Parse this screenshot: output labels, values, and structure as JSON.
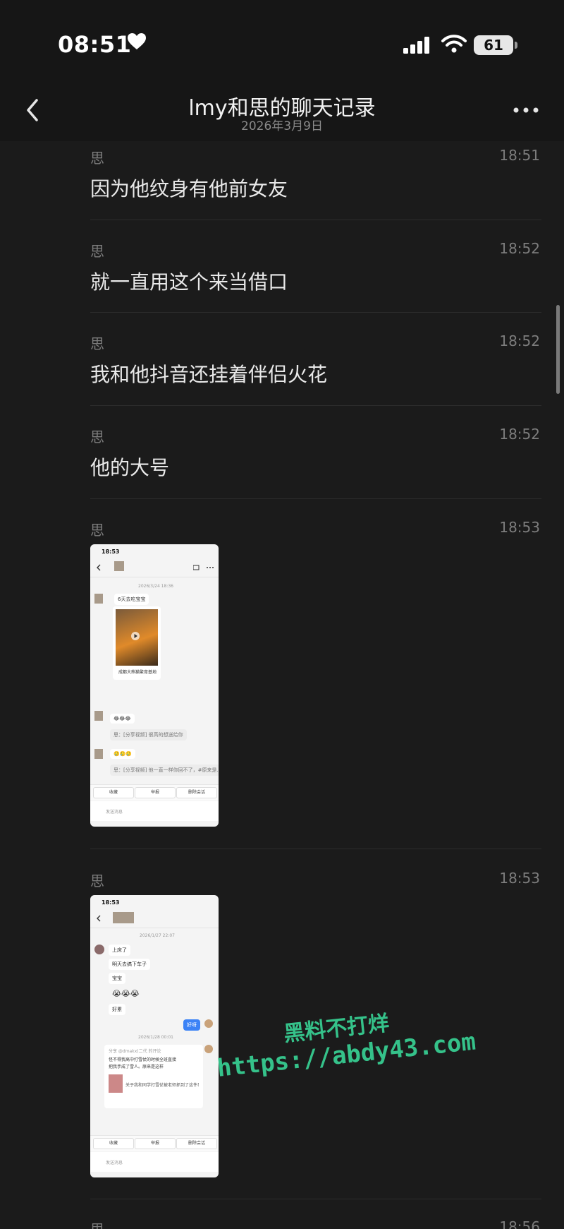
{
  "status_bar": {
    "time": "08:51",
    "battery": "61"
  },
  "header": {
    "title": "lmy和思的聊天记录",
    "date": "2026年3月9日"
  },
  "messages": [
    {
      "sender": "思",
      "time": "18:51",
      "text": "因为他纹身有他前女友"
    },
    {
      "sender": "思",
      "time": "18:52",
      "text": "就一直用这个来当借口"
    },
    {
      "sender": "思",
      "time": "18:52",
      "text": "我和他抖音还挂着伴侣火花"
    },
    {
      "sender": "思",
      "time": "18:52",
      "text": "他的大号"
    },
    {
      "sender": "思",
      "time": "18:53"
    },
    {
      "sender": "思",
      "time": "18:53"
    },
    {
      "sender": "思",
      "time": "18:56"
    }
  ],
  "screenshot1": {
    "time": "18:53",
    "date": "2026/3/24 18:36",
    "bubble_top": "6天去吃宝宝",
    "location": "成都大熊猫繁育基地",
    "emoji_row": "😂😂😂",
    "quote1": "思：[分享视频] 很高的想送给你",
    "emoji_row2": "🥲🥲🥲",
    "quote2": "思：[分享视频] 他一直一样你回不了，#原来是...",
    "btn1": "收藏",
    "btn2": "举报",
    "btn3": "删除会话",
    "input_placeholder": "发送消息"
  },
  "screenshot2": {
    "time": "18:53",
    "date": "2026/1/27 22:07",
    "lines": [
      "上床了",
      "明天去搞下车子",
      "宝宝",
      "😭😭😭",
      "好累"
    ],
    "sent": "好呀",
    "date2": "2026/1/28 00:01",
    "share_title": "分享 @dmakx(二代 的评论",
    "share_text1": "怪不得我高中打雪仗的时候全班直接",
    "share_text2": "把我手成了雪人。原来是这样",
    "share_card": "关于我和同学打雪仗被老师抓到了这件事#打雪仗#校园 #女大...",
    "btn1": "收藏",
    "btn2": "举报",
    "btn3": "删除会话",
    "input_placeholder": "发送消息"
  },
  "watermark": {
    "line1": "黑料不打烊",
    "line2": "https://abdy43.com"
  }
}
